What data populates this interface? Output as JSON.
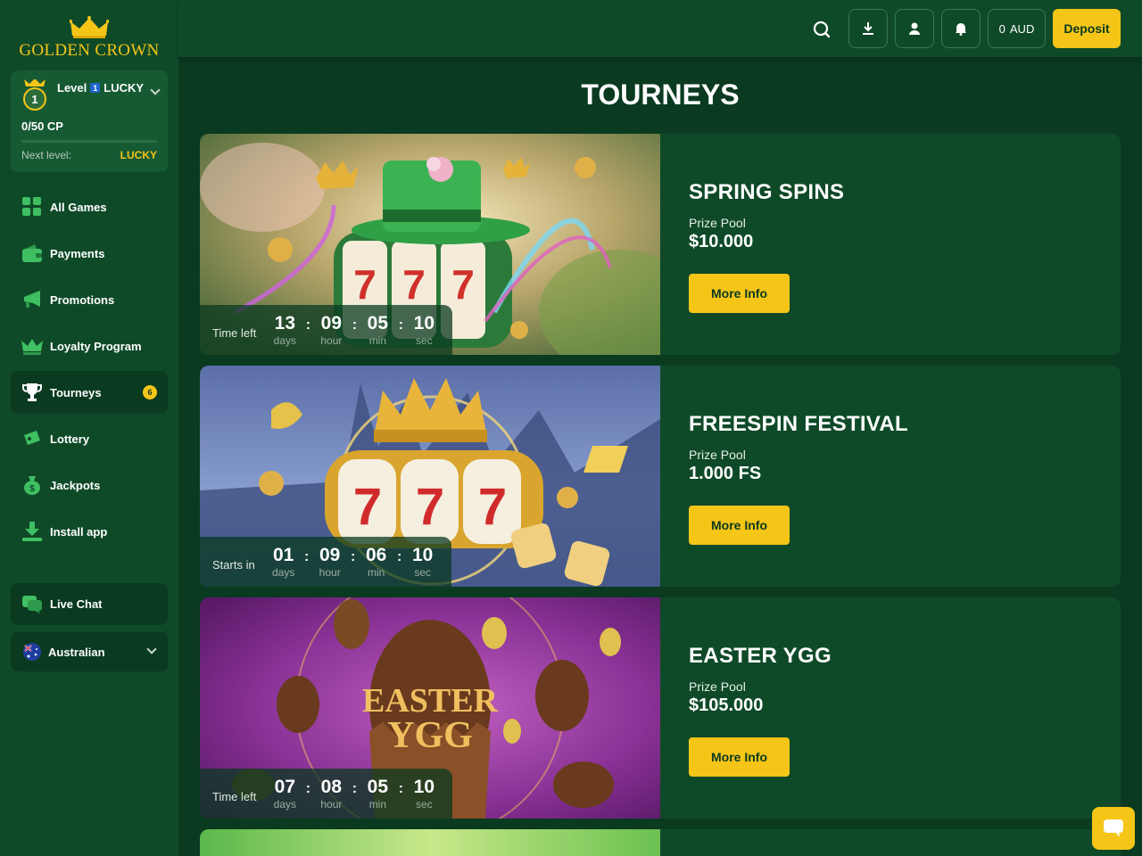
{
  "brand": {
    "name": "GOLDEN CROWN"
  },
  "level": {
    "word": "Level",
    "number": "1",
    "name": "LUCKY",
    "badge_number": "1",
    "points": "0/50 CP",
    "progress": 0,
    "next_label": "Next level:",
    "next_value": "LUCKY"
  },
  "nav": [
    {
      "label": "All Games",
      "icon": "grid-icon"
    },
    {
      "label": "Payments",
      "icon": "wallet-icon"
    },
    {
      "label": "Promotions",
      "icon": "megaphone-icon"
    },
    {
      "label": "Loyalty Program",
      "icon": "crown-icon"
    },
    {
      "label": "Tourneys",
      "icon": "trophy-icon",
      "badge": "6",
      "active": true
    },
    {
      "label": "Lottery",
      "icon": "ticket-icon"
    },
    {
      "label": "Jackpots",
      "icon": "money-bag-icon"
    },
    {
      "label": "Install app",
      "icon": "download-icon"
    }
  ],
  "live_chat": "Live Chat",
  "language": "Australian",
  "header": {
    "balance_amount": "0",
    "balance_currency": "AUD",
    "deposit": "Deposit"
  },
  "page_title": "TOURNEYS",
  "tourneys": [
    {
      "name": "SPRING SPINS",
      "pool_label": "Prize Pool",
      "pool": "$10.000",
      "timer_label": "Time left",
      "days": "13",
      "hours": "09",
      "mins": "05",
      "secs": "10",
      "button": "More Info"
    },
    {
      "name": "FREESPIN FESTIVAL",
      "pool_label": "Prize Pool",
      "pool": "1.000 FS",
      "timer_label": "Starts in",
      "days": "01",
      "hours": "09",
      "mins": "06",
      "secs": "10",
      "button": "More Info"
    },
    {
      "name": "EASTER YGG",
      "pool_label": "Prize Pool",
      "pool": "$105.000",
      "timer_label": "Time left",
      "days": "07",
      "hours": "08",
      "mins": "05",
      "secs": "10",
      "button": "More Info"
    }
  ],
  "units": {
    "days": "days",
    "hour": "hour",
    "min": "min",
    "sec": "sec"
  },
  "image_texts": {
    "easter_art": "EASTER YGG"
  },
  "colors": {
    "accent": "#f5c518",
    "sidebar": "#0f4a28",
    "background": "#0a3a20"
  }
}
